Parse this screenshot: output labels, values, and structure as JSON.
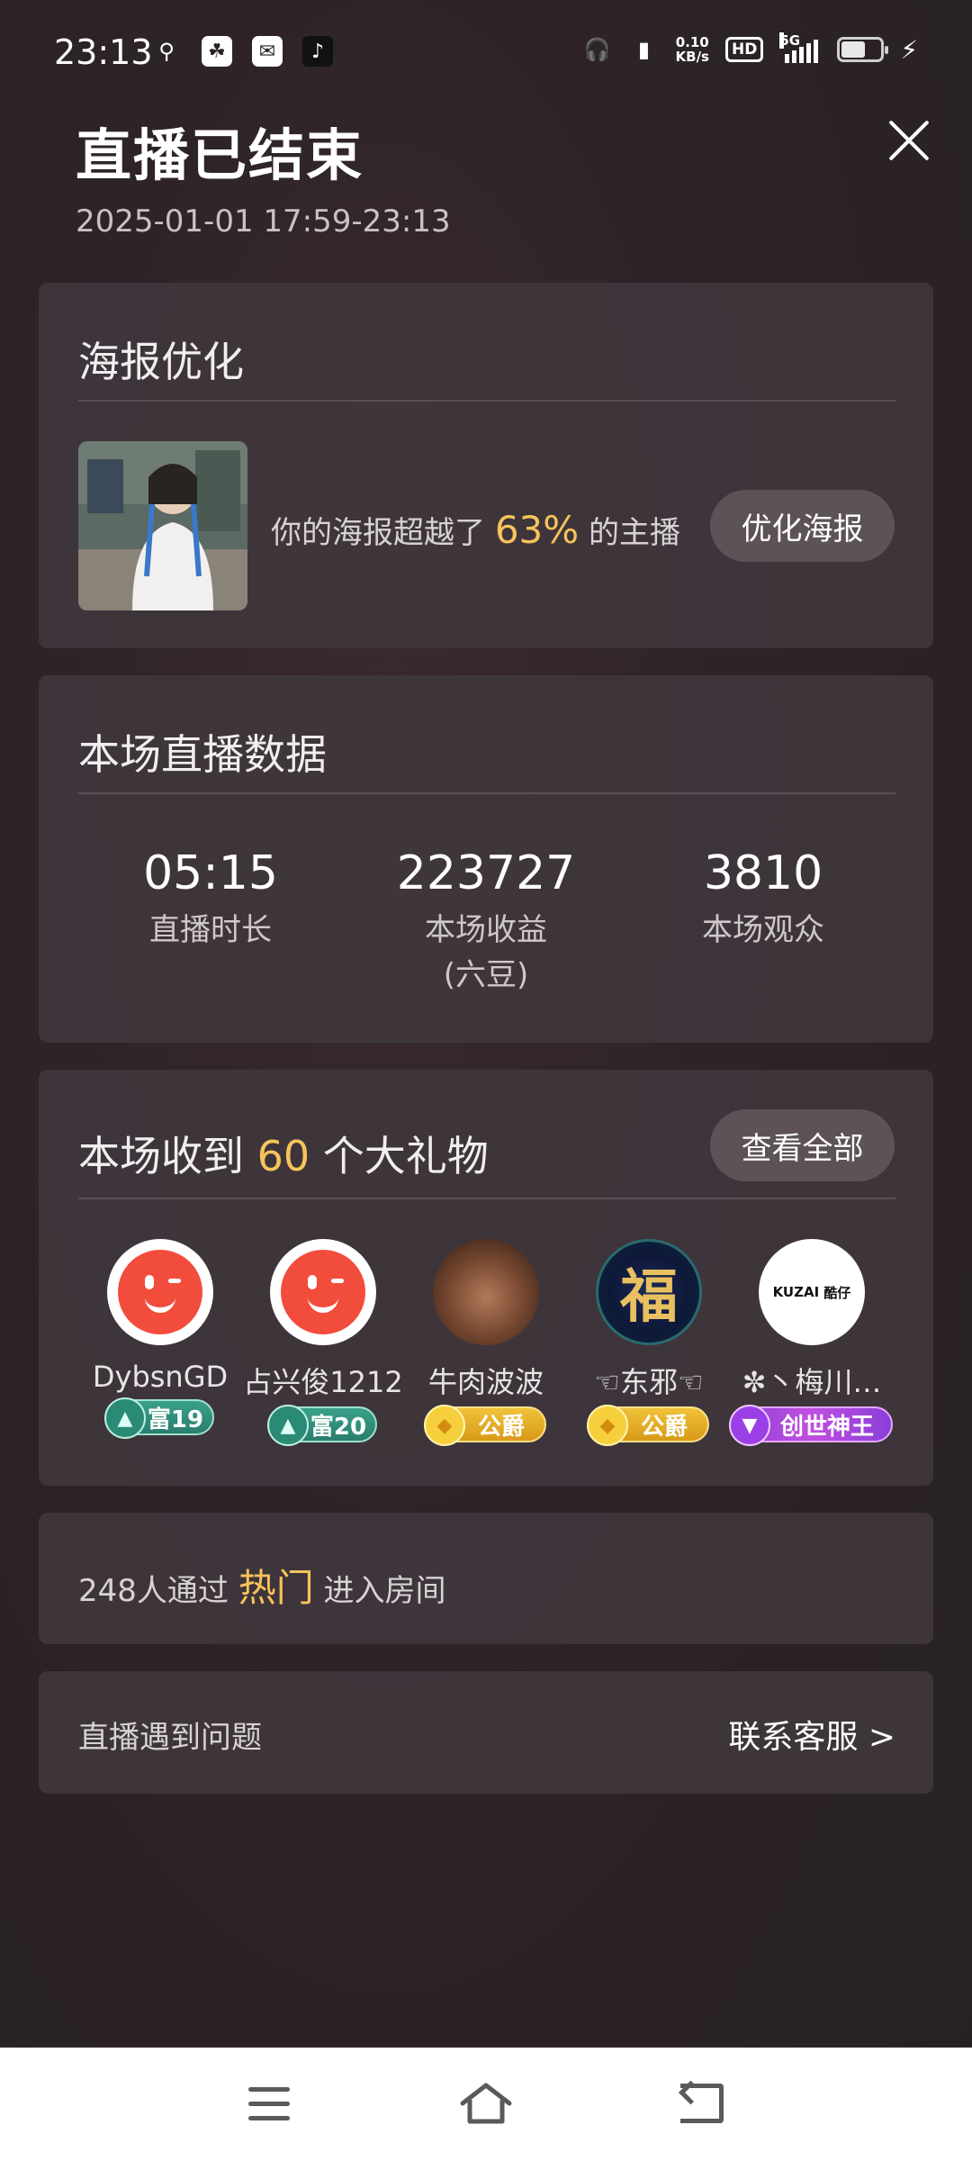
{
  "status_bar": {
    "time": "23:13",
    "net_speed_value": "0.10",
    "net_speed_unit": "KB/s",
    "hd_label": "HD",
    "network_label": "5G",
    "battery_level": 0.55,
    "icons": [
      "usb-icon",
      "baidu-icon",
      "mail-icon",
      "tiktok-icon",
      "headphones-icon",
      "vibrate-icon",
      "signal-icon",
      "battery-icon",
      "charging-icon"
    ]
  },
  "header": {
    "title": "直播已结束",
    "time_range": "2025-01-01 17:59-23:13"
  },
  "poster": {
    "title": "海报优化",
    "text_before": "你的海报超越了",
    "percent": "63%",
    "text_after": "的主播",
    "button": "优化海报"
  },
  "stats": {
    "title": "本场直播数据",
    "items": [
      {
        "value": "05:15",
        "label": "直播时长",
        "sub": ""
      },
      {
        "value": "223727",
        "label": "本场收益",
        "sub": "(六豆)"
      },
      {
        "value": "3810",
        "label": "本场观众",
        "sub": ""
      }
    ]
  },
  "gifts": {
    "title_before": "本场收到",
    "count": "60",
    "title_after": "个大礼物",
    "button": "查看全部",
    "users": [
      {
        "name": "DybsnGD",
        "badge": "富19",
        "badge_type": "rich"
      },
      {
        "name": "占兴俊1212",
        "badge": "富20",
        "badge_type": "rich"
      },
      {
        "name": "牛肉波波",
        "badge": "公爵",
        "badge_type": "duke"
      },
      {
        "name": "☜东邪☜",
        "badge": "公爵",
        "badge_type": "duke"
      },
      {
        "name": "✼丶梅川…",
        "badge": "创世神王",
        "badge_type": "god"
      }
    ],
    "avatar_texts": {
      "fu": "福",
      "kuzai_left": "KUZAI",
      "kuzai_right": "酷仔"
    }
  },
  "hot": {
    "text_before": "248人通过",
    "highlight": "热门",
    "text_after": "进入房间"
  },
  "problem": {
    "left": "直播遇到问题",
    "right": "联系客服 >"
  },
  "colors": {
    "accent": "#f7c35a",
    "card_bg": "#40383e",
    "pill_bg": "#5c5257"
  }
}
